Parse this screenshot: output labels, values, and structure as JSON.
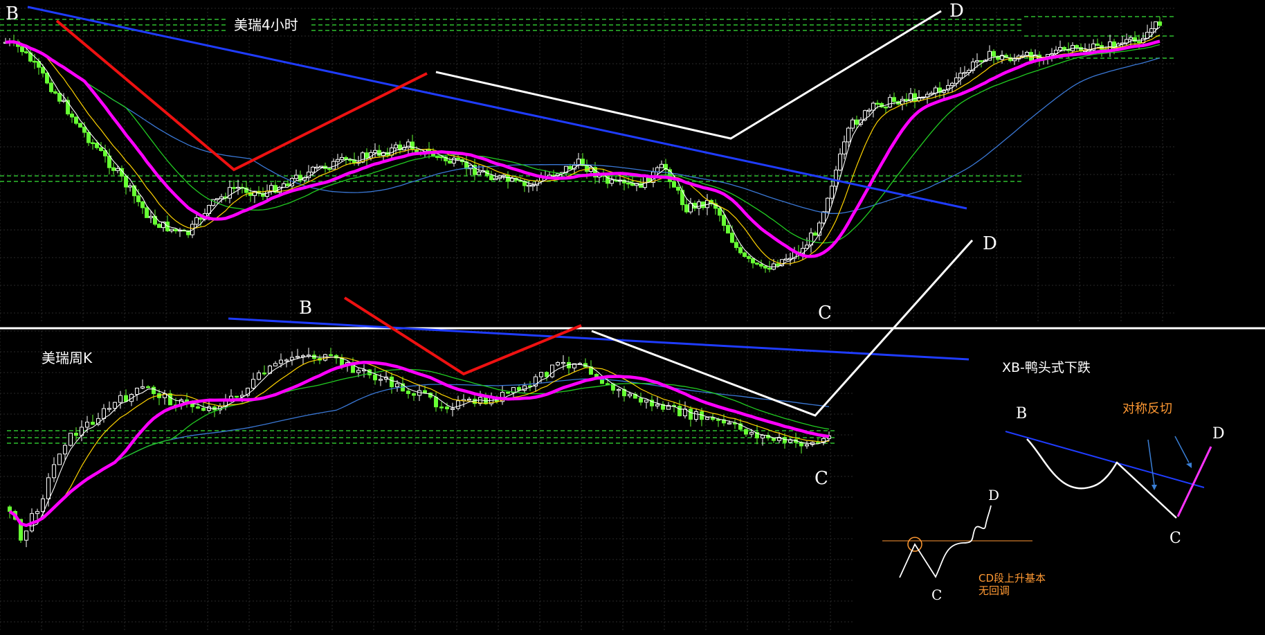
{
  "chart_data": [
    {
      "type": "candlestick",
      "title": "美瑞4小时",
      "points": {
        "B": "B",
        "C": "C",
        "D": "D"
      },
      "colors": {
        "up": "#ffffff",
        "down": "#66ff33",
        "ma_main": "#ff00ff",
        "ma_white": "#ffffff",
        "ma_yellow": "#ffd400",
        "ma_green": "#22cc22",
        "ma_blue": "#3a78d6",
        "trend": "#1f3cff",
        "wave_red": "#ee1111",
        "wave_white": "#ffffff",
        "level": "#2fbf2f",
        "grid": "#2a2a2a"
      }
    },
    {
      "type": "candlestick",
      "title": "美瑞周K",
      "points": {
        "B": "B",
        "C": "C"
      }
    }
  ],
  "diagram": {
    "title": "XB-鸭头式下跌",
    "note": "对称反切",
    "points": {
      "B": "B",
      "C": "C",
      "D": "D"
    },
    "mini": {
      "C": "C",
      "D": "D",
      "caption": "CD段上升基本无回调"
    }
  }
}
